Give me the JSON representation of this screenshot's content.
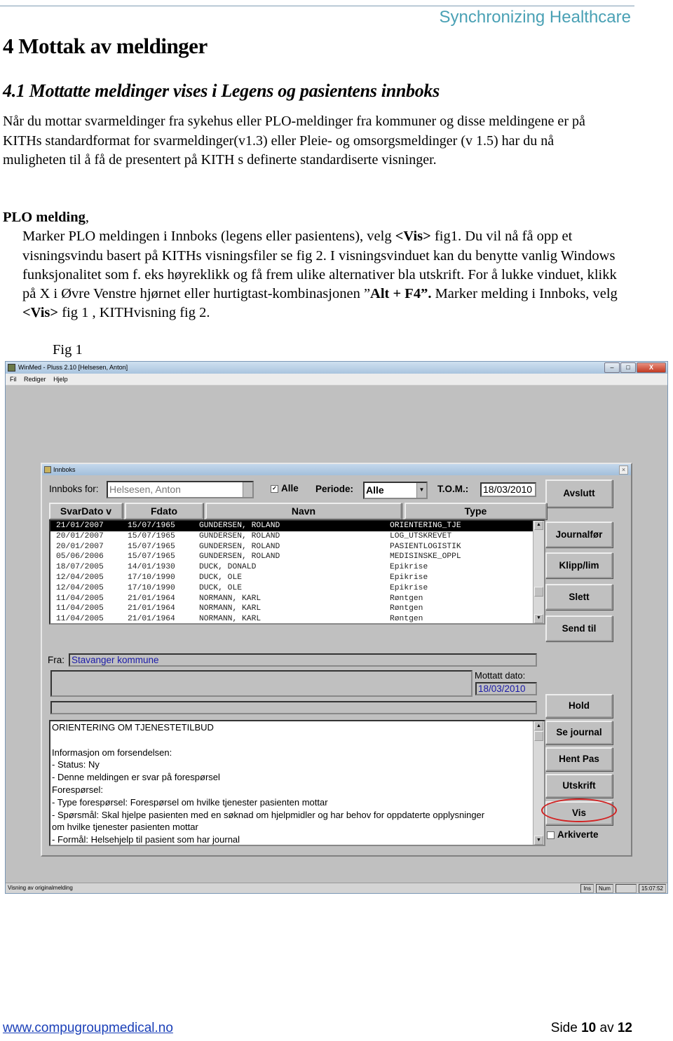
{
  "header": {
    "brand": "Synchronizing Healthcare"
  },
  "heading1": "4  Mottak av meldinger",
  "heading2": "4.1 Mottatte meldinger vises i Legens og pasientens innboks",
  "intro": "Når du mottar svarmeldinger fra sykehus eller PLO-meldinger fra kommuner og disse meldingene er på KITHs standardformat for svarmeldinger(v1.3) eller Pleie- og omsorgsmeldinger (v 1.5) har du nå muligheten til å få de presentert på KITH s definerte standardiserte visninger.",
  "plo": {
    "title": "PLO melding",
    "title_suffix": ",",
    "p1": "Marker PLO meldingen i Innboks (legens eller pasientens), velg ",
    "vis1": "<Vis>",
    "p2": " fig1.  Du vil nå få opp et visningsvindu basert på KITHs visningsfiler se fig 2.  I visningsvinduet kan du benytte vanlig Windows funksjonalitet som f. eks høyreklikk og få frem ulike alternativer bla utskrift. For å lukke vinduet, klikk på X i Øvre Venstre hjørnet eller hurtigtast-kombinasjonen ”",
    "alt": "Alt + F4”.",
    "p3": " Marker melding i Innboks, velg ",
    "vis2": "<Vis>",
    "p4": " fig 1 , KITHvisning fig 2."
  },
  "figure_caption": "Fig 1",
  "app": {
    "title": "WinMed - Pluss 2.10 [Helsesen, Anton]",
    "window_buttons": {
      "minimize": "–",
      "maximize": "□",
      "close": "X"
    },
    "menu": [
      "Fil",
      "Rediger",
      "Hjelp"
    ],
    "status_text": "Visning av originalmelding",
    "status_cells": [
      "Ins",
      "Num",
      "",
      "15:07:52"
    ],
    "dialog": {
      "title": "Innboks",
      "close": "×",
      "innboks_for_label": "Innboks for:",
      "innboks_for_value": "Helsesen, Anton",
      "alle_label": "Alle",
      "alle_checked": true,
      "periode_label": "Periode:",
      "periode_value": "Alle",
      "tom_label": "T.O.M.:",
      "tom_value": "18/03/2010",
      "columns": [
        "SvarDato  v",
        "Fdato",
        "Navn",
        "Type"
      ],
      "rows": [
        [
          "21/01/2007",
          "15/07/1965",
          "GUNDERSEN, ROLAND",
          "ORIENTERING_TJE"
        ],
        [
          "20/01/2007",
          "15/07/1965",
          "GUNDERSEN, ROLAND",
          "LOG_UTSKREVET"
        ],
        [
          "20/01/2007",
          "15/07/1965",
          "GUNDERSEN, ROLAND",
          "PASIENTLOGISTIK"
        ],
        [
          "05/06/2006",
          "15/07/1965",
          "GUNDERSEN, ROLAND",
          "MEDISINSKE_OPPL"
        ],
        [
          "18/07/2005",
          "14/01/1930",
          "DUCK, DONALD",
          "Epikrise"
        ],
        [
          "12/04/2005",
          "17/10/1990",
          "DUCK, OLE",
          "Epikrise"
        ],
        [
          "12/04/2005",
          "17/10/1990",
          "DUCK, OLE",
          "Epikrise"
        ],
        [
          "11/04/2005",
          "21/01/1964",
          "NORMANN, KARL",
          "Røntgen"
        ],
        [
          "11/04/2005",
          "21/01/1964",
          "NORMANN, KARL",
          "Røntgen"
        ],
        [
          "11/04/2005",
          "21/01/1964",
          "NORMANN, KARL",
          "Røntgen"
        ]
      ],
      "fra_label": "Fra:",
      "fra_value": "Stavanger kommune",
      "mottatt_label": "Mottatt dato:",
      "mottatt_value": "18/03/2010",
      "message_lines": [
        "ORIENTERING OM TJENESTETILBUD",
        "",
        "Informasjon om forsendelsen:",
        "- Status: Ny",
        "- Denne meldingen er svar på forespørsel",
        "Forespørsel:",
        "- Type forespørsel: Forespørsel om hvilke tjenester pasienten mottar",
        "- Spørsmål: Skal hjelpe pasienten med en søknad om hjelpmidler og har behov for oppdaterte opplysninger",
        "om hvilke tjenester pasienten mottar",
        "- Formål: Helsehjelp til pasient som har journal"
      ],
      "buttons": {
        "avslutt": "Avslutt",
        "journalfor": "Journalfør",
        "klipp": "Klipp/lim",
        "slett": "Slett",
        "send": "Send til",
        "hold": "Hold",
        "se_journal": "Se journal",
        "hent_pas": "Hent Pas",
        "utskrift": "Utskrift",
        "vis": "Vis"
      },
      "arkiverte_label": "Arkiverte",
      "arkiverte_checked": false,
      "highlight_color": "#d22222"
    }
  },
  "footer": {
    "link": "www.compugroupmedical.no",
    "page_prefix": "Side ",
    "page": "10",
    "page_mid": " av ",
    "total": "12"
  }
}
